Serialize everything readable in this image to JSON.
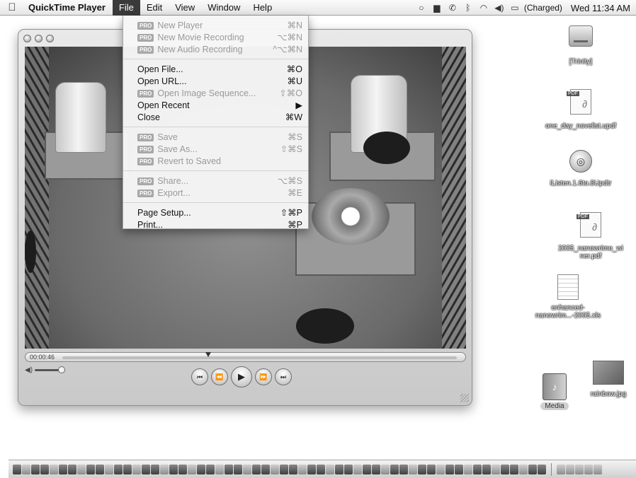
{
  "menubar": {
    "apple_icon": "apple-icon",
    "app_name": "QuickTime Player",
    "menus": [
      "File",
      "Edit",
      "View",
      "Window",
      "Help"
    ],
    "status_icons": [
      "spotlight-icon",
      "display-icon",
      "phone-icon",
      "bluetooth-icon",
      "wifi-icon",
      "volume-icon",
      "battery-icon"
    ],
    "battery_text": "(Charged)",
    "clock": "Wed 11:34 AM"
  },
  "file_menu": {
    "pro_badge": "PRO",
    "groups": [
      [
        {
          "label": "New Player",
          "shortcut": "⌘N",
          "pro": true,
          "disabled": true
        },
        {
          "label": "New Movie Recording",
          "shortcut": "⌥⌘N",
          "pro": true,
          "disabled": true
        },
        {
          "label": "New Audio Recording",
          "shortcut": "^⌥⌘N",
          "pro": true,
          "disabled": true
        }
      ],
      [
        {
          "label": "Open File...",
          "shortcut": "⌘O",
          "pro": false,
          "disabled": false
        },
        {
          "label": "Open URL...",
          "shortcut": "⌘U",
          "pro": false,
          "disabled": false
        },
        {
          "label": "Open Image Sequence...",
          "shortcut": "⇧⌘O",
          "pro": true,
          "disabled": true
        },
        {
          "label": "Open Recent",
          "shortcut": "▶",
          "pro": false,
          "disabled": false
        },
        {
          "label": "Close",
          "shortcut": "⌘W",
          "pro": false,
          "disabled": false
        }
      ],
      [
        {
          "label": "Save",
          "shortcut": "⌘S",
          "pro": true,
          "disabled": true
        },
        {
          "label": "Save As...",
          "shortcut": "⇧⌘S",
          "pro": true,
          "disabled": true
        },
        {
          "label": "Revert to Saved",
          "shortcut": "",
          "pro": true,
          "disabled": true
        }
      ],
      [
        {
          "label": "Share...",
          "shortcut": "⌥⌘S",
          "pro": true,
          "disabled": true
        },
        {
          "label": "Export...",
          "shortcut": "⌘E",
          "pro": true,
          "disabled": true
        }
      ],
      [
        {
          "label": "Page Setup...",
          "shortcut": "⇧⌘P",
          "pro": false,
          "disabled": false
        },
        {
          "label": "Print...",
          "shortcut": "⌘P",
          "pro": false,
          "disabled": false
        }
      ]
    ]
  },
  "player": {
    "time": "00:00:46",
    "progress_fraction": 0.37,
    "volume_fraction": 1.0,
    "controls": [
      {
        "name": "go-to-start-button",
        "glyph": "⏮",
        "big": false
      },
      {
        "name": "rewind-button",
        "glyph": "⏪",
        "big": false
      },
      {
        "name": "play-button",
        "glyph": "▶",
        "big": true
      },
      {
        "name": "fast-forward-button",
        "glyph": "⏩",
        "big": false
      },
      {
        "name": "go-to-end-button",
        "glyph": "⏭",
        "big": false
      }
    ]
  },
  "desktop": {
    "icons": [
      {
        "kind": "hdd",
        "label": "[Trinity]"
      },
      {
        "kind": "pdf",
        "tag": "PDF",
        "label": "one_day_novelist.updf"
      },
      {
        "kind": "app",
        "label": "iListen.1.6to.8Updtr"
      },
      {
        "kind": "pdf",
        "tag": "PDF",
        "label": "2005_nanowrimo_wi\nner.pdf"
      },
      {
        "kind": "sheet",
        "label": "enhanced-\nnanowrim...-2005.xls"
      },
      {
        "kind": "media",
        "label": "Media"
      },
      {
        "kind": "image",
        "label": "rainbow.jpg"
      }
    ]
  },
  "dock": {
    "item_count": 58,
    "trailing_count": 5
  }
}
